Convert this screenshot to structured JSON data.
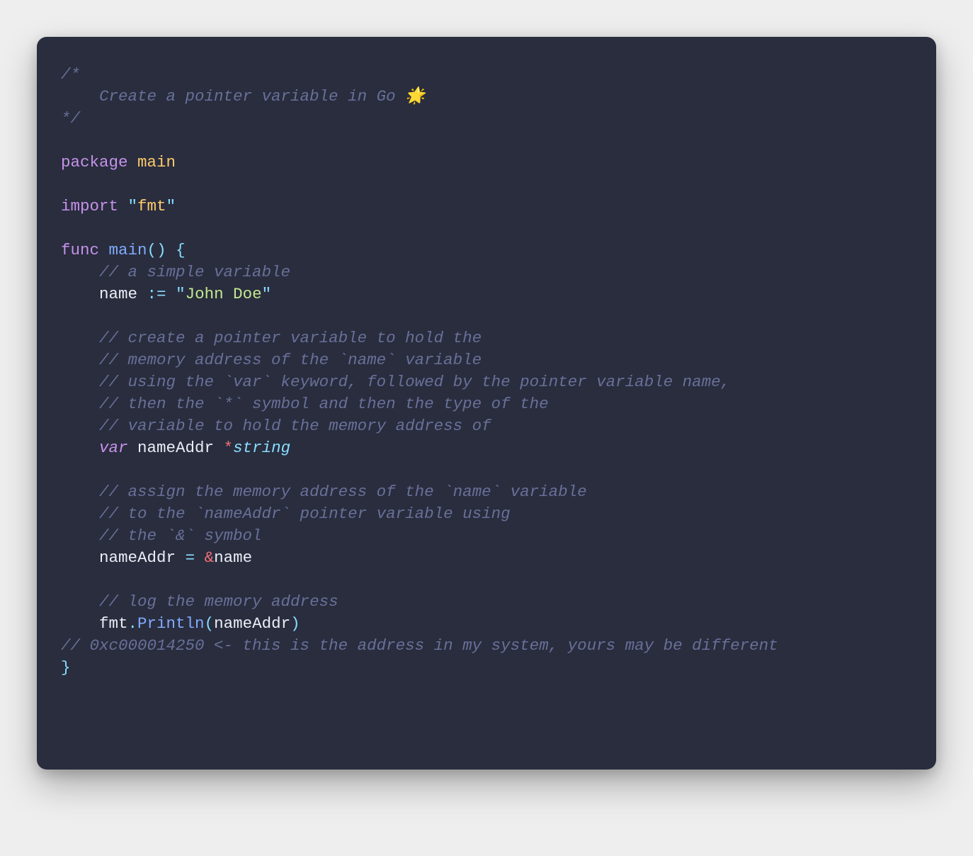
{
  "code": {
    "comment_block_open": "/*",
    "comment_block_line": "    Create a pointer variable in Go 🌟",
    "comment_block_close": "*/",
    "kw_package": "package",
    "pkgname_main": "main",
    "kw_import": "import",
    "import_pkg": "fmt",
    "kw_func": "func",
    "funcname_main": "main",
    "open_paren": "(",
    "close_paren": ")",
    "open_brace": "{",
    "close_brace": "}",
    "comment_simple_var": "// a simple variable",
    "ident_name": "name",
    "op_decl": ":=",
    "str_john": "John Doe",
    "cmt_ptr1": "// create a pointer variable to hold the",
    "cmt_ptr2": "// memory address of the `name` variable",
    "cmt_ptr3": "// using the `var` keyword, followed by the pointer variable name,",
    "cmt_ptr4": "// then the `*` symbol and then the type of the",
    "cmt_ptr5": "// variable to hold the memory address of",
    "kw_var": "var",
    "ident_nameAddr": "nameAddr",
    "star": "*",
    "type_string": "string",
    "cmt_asn1": "// assign the memory address of the `name` variable",
    "cmt_asn2": "// to the `nameAddr` pointer variable using",
    "cmt_asn3": "// the `&` symbol",
    "op_eq": "=",
    "amp": "&",
    "cmt_log": "// log the memory address",
    "ident_fmt": "fmt",
    "dot": ".",
    "func_println": "Println",
    "cmt_addr": "// 0xc000014250 <- this is the address in my system, yours may be different"
  }
}
